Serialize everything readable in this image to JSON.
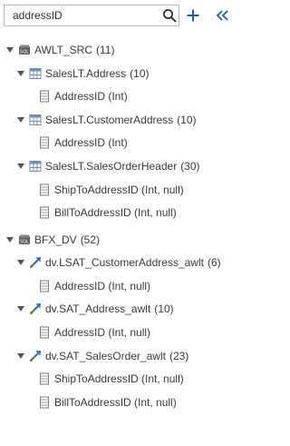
{
  "search": {
    "value": "addressID"
  },
  "icons": {
    "search": "search-icon",
    "add": "plus-icon",
    "collapse": "double-chevron-left-icon",
    "database": "database-icon",
    "table": "table-icon",
    "column": "column-icon",
    "satellite": "satellite-link-icon"
  },
  "colors": {
    "accent": "#1f5fa8",
    "table_icon": "#6f8fb8",
    "satellite_green": "#4e8a3e",
    "satellite_blue": "#2d6cc0"
  },
  "tree": {
    "nodes": [
      {
        "label": "AWLT_SRC",
        "count": "(11)",
        "children": [
          {
            "label": "SalesLT.Address",
            "count": "(10)",
            "children": [
              {
                "label": "AddressID (Int)"
              }
            ]
          },
          {
            "label": "SalesLT.CustomerAddress",
            "count": "(10)",
            "children": [
              {
                "label": "AddressID (Int)"
              }
            ]
          },
          {
            "label": "SalesLT.SalesOrderHeader",
            "count": "(30)",
            "children": [
              {
                "label": "ShipToAddressID (Int, null)"
              },
              {
                "label": "BillToAddressID (Int, null)"
              }
            ]
          }
        ]
      },
      {
        "label": "BFX_DV",
        "count": "(52)",
        "children": [
          {
            "label": "dv.LSAT_CustomerAddress_awlt",
            "count": "(6)",
            "children": [
              {
                "label": "AddressID (Int, null)"
              }
            ]
          },
          {
            "label": "dv.SAT_Address_awlt",
            "count": "(10)",
            "children": [
              {
                "label": "AddressID (Int, null)"
              }
            ]
          },
          {
            "label": "dv.SAT_SalesOrder_awlt",
            "count": "(23)",
            "children": [
              {
                "label": "ShipToAddressID (Int, null)"
              },
              {
                "label": "BillToAddressID (Int, null)"
              }
            ]
          }
        ]
      }
    ]
  }
}
